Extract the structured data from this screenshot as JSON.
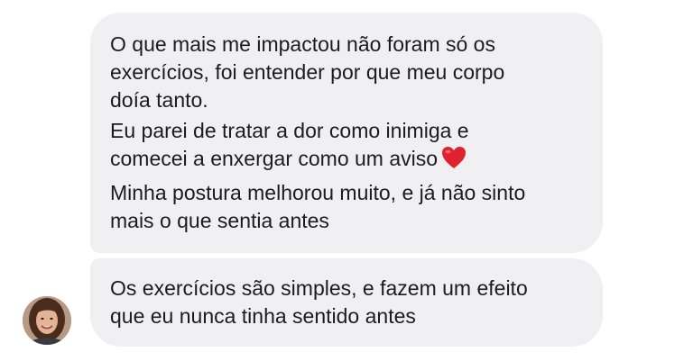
{
  "messages": [
    {
      "paragraphs": [
        {
          "lines": [
            "O que mais me impactou não foram só os",
            "exercícios, foi entender por que meu corpo",
            "doía tanto."
          ]
        },
        {
          "lines": [
            "Eu parei de tratar a dor como inimiga e",
            "comecei a enxergar como um aviso"
          ],
          "trailing_icon": "red-heart-emoji"
        },
        {
          "lines": [
            "Minha postura melhorou muito, e já não sinto",
            "mais o que sentia antes"
          ]
        }
      ]
    },
    {
      "paragraphs": [
        {
          "lines": [
            "Os exercícios são simples, e fazem um efeito",
            "que eu nunca tinha sentido antes"
          ]
        }
      ]
    }
  ],
  "sender": {
    "avatar_icon": "user-avatar-photo"
  },
  "colors": {
    "bubble_background": "#f0f0f2",
    "text": "#1c1c1e",
    "heart": "#e0222e"
  }
}
